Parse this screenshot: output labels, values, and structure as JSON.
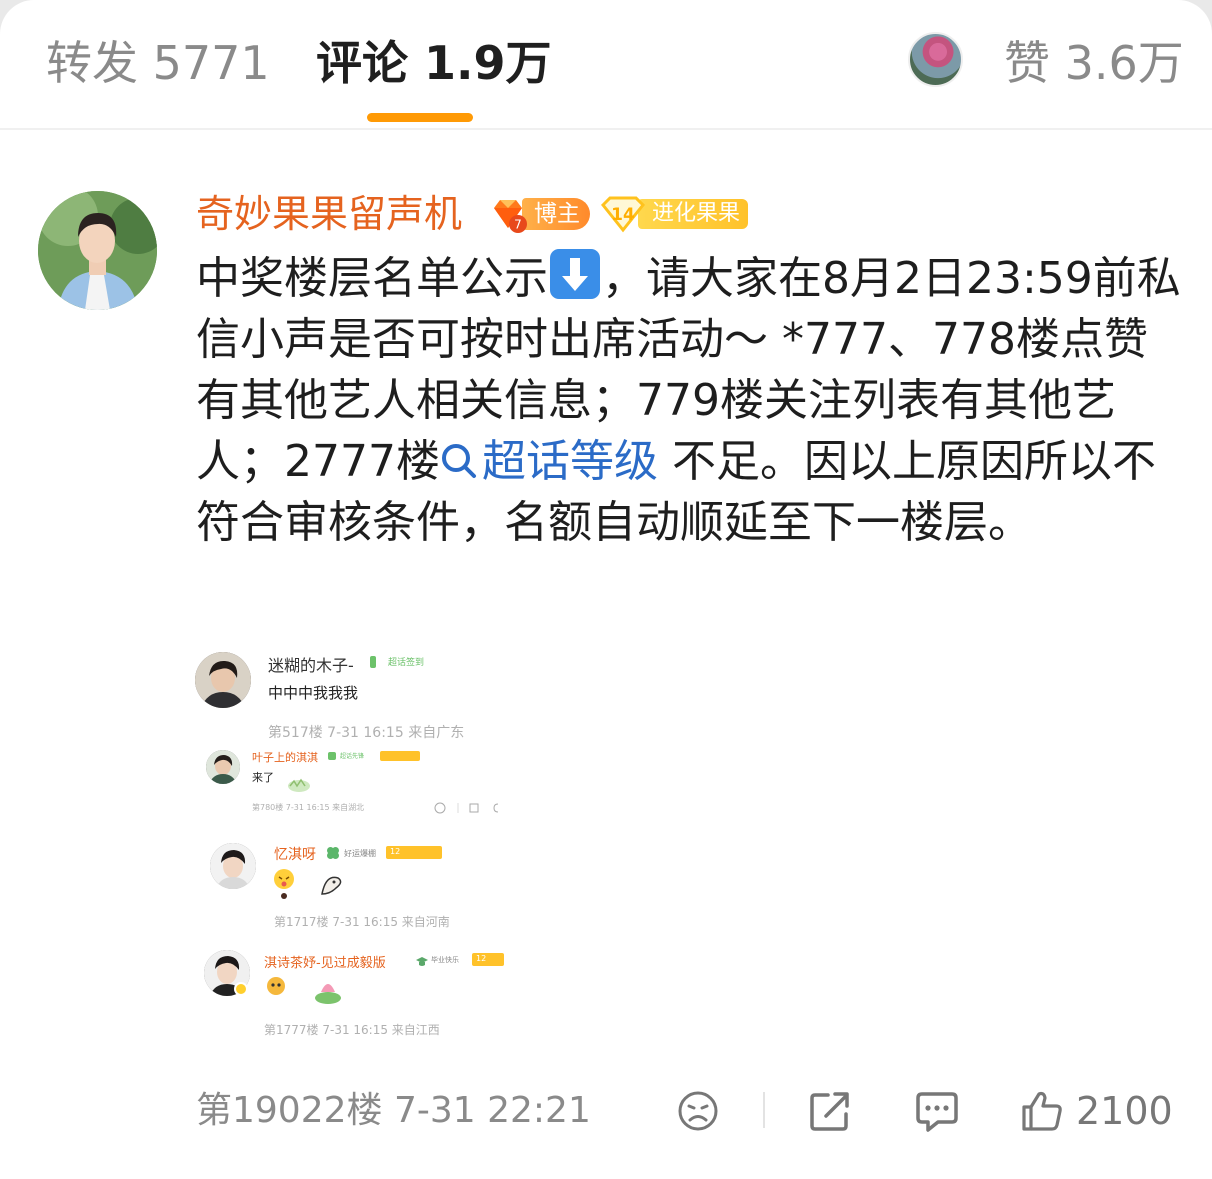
{
  "tabs": {
    "repost_label": "转发 5771",
    "comment_label": "评论 1.9万",
    "like_label": "赞 3.6万"
  },
  "comment": {
    "username": "奇妙果果留声机",
    "badge_host": "博主",
    "badge_host_level": "7",
    "badge_fan": "进化果果",
    "badge_fan_level": "14",
    "text_part1": "中奖楼层名单公示",
    "arrow_icon": "down-arrow-emoji-icon",
    "text_part2": "，请大家在8月2日23:59前私信小声是否可按时出席活动～ *777、778楼点赞有其他艺人相关信息；779楼关注列表有其他艺人；2777楼",
    "topic_link": "超话等级",
    "text_part3": " 不足。因以上原因所以不符合审核条件，名额自动顺延至下一楼层。",
    "floor_meta": "第19022楼 7-31 22:21",
    "like_count": "2100"
  },
  "screenshot": {
    "items": [
      {
        "name": "迷糊的木子-",
        "tag": "超话签到",
        "text": "中中中我我我",
        "meta": "第517楼 7-31 16:15 来自广东"
      },
      {
        "name": "叶子上的淇淇",
        "tag": "超话先锋",
        "text": "来了",
        "meta": "第780楼 7-31 16:15 来自湖北"
      },
      {
        "name": "忆淇呀",
        "tag": "好运爆棚",
        "level": "12",
        "meta": "第1717楼 7-31 16:15 来自河南"
      },
      {
        "name": "淇诗茶妤-见过成毅版",
        "tag": "毕业快乐",
        "level": "12",
        "meta": "第1777楼 7-31 16:15 来自江西"
      }
    ]
  },
  "colors": {
    "accent": "#ff9a05",
    "username": "#e5631f",
    "link": "#2b6bc7",
    "meta": "#8a8a8a"
  },
  "icons": [
    "sad-face-icon",
    "share-icon",
    "comment-bubble-icon",
    "thumbs-up-icon",
    "search-topic-icon"
  ]
}
